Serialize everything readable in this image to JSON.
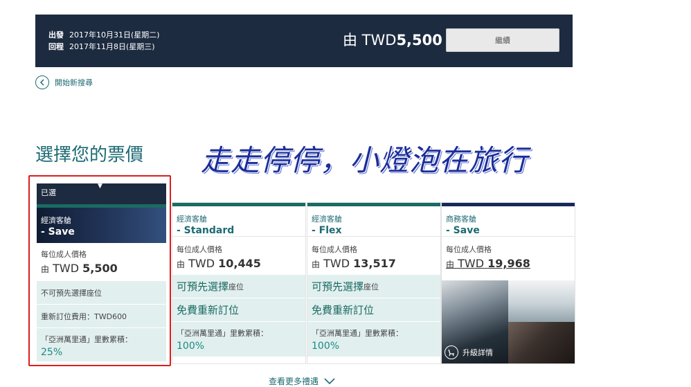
{
  "summary": {
    "depart_label": "出發",
    "depart_date": "2017年10月31日(星期二)",
    "return_label": "回程",
    "return_date": "2017年11月8日(星期三)",
    "price_prefix": "由 TWD",
    "price_amount": "5,500",
    "continue_label": "繼續"
  },
  "new_search_label": "開始新搜尋",
  "section_title": "選擇您的票價",
  "slogan": "走走停停，小燈泡在旅行",
  "selected_label": "已選",
  "price_label": "每位成人價格",
  "price_from": "由",
  "currency": "TWD",
  "miles_label": "「亞洲萬里通」里數累積：",
  "fares": [
    {
      "cabin": "經濟客艙",
      "name": "- Save",
      "price": "5,500",
      "seat": "不可預先選擇座位",
      "rebook": "重新訂位費用：TWD600",
      "miles": "25%"
    },
    {
      "cabin": "經濟客艙",
      "name": "- Standard",
      "price": "10,445",
      "seat_main": "可預先選擇",
      "seat_sub": "座位",
      "rebook": "免費重新訂位",
      "miles": "100%"
    },
    {
      "cabin": "經濟客艙",
      "name": "- Flex",
      "price": "13,517",
      "seat_main": "可預先選擇",
      "seat_sub": "座位",
      "rebook": "免費重新訂位",
      "miles": "100%"
    },
    {
      "cabin": "商務客艙",
      "name": "- Save",
      "price": "19,968",
      "upgrade_label": "升級詳情"
    }
  ],
  "more_benefits": "查看更多禮遇",
  "colors": {
    "navy": "#1d2b40",
    "teal": "#1a6b62",
    "accent_text": "#1d6a73",
    "highlight_border": "#d91e1e",
    "slogan": "#1b2e99"
  }
}
